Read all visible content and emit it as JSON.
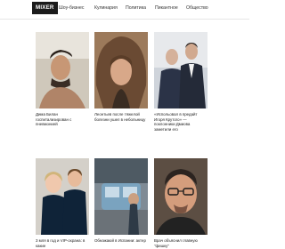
{
  "header": {
    "logo": "MIXER",
    "nav": [
      "Шоу-бизнес",
      "Кулинария",
      "Политика",
      "Пикантное",
      "Общество"
    ]
  },
  "articles": [
    {
      "title": "Дима Билан госпитализирован с пневмонией"
    },
    {
      "title": "Леонтьев после тяжелой болезни ушел в небольницу"
    },
    {
      "title": "«Испольовал в предайт Игоря Крутого» — поклонники Дмиова заметили его"
    },
    {
      "title": "3 мля в год и VIP-охрана: в какие"
    },
    {
      "title": "Обнажаюй в Испании: актер"
    },
    {
      "title": "Врач объяснил главную \"фишку\""
    }
  ],
  "colors": {
    "logo_bg": "#1b1b1b",
    "logo_text": "#ffffff",
    "nav_text": "#333333",
    "title_text": "#222222"
  }
}
